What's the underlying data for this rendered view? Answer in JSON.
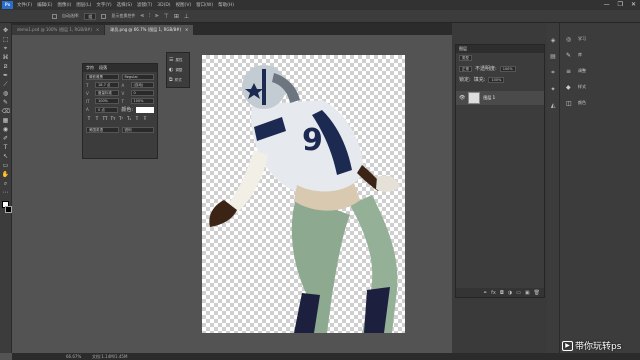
{
  "menu": [
    "文件(F)",
    "编辑(E)",
    "图像(I)",
    "图层(L)",
    "文字(Y)",
    "选择(S)",
    "滤镜(T)",
    "3D(D)",
    "视图(V)",
    "窗口(W)",
    "帮助(H)"
  ],
  "ps_logo": "Ps",
  "window_controls": {
    "minimize": "—",
    "restore": "❐",
    "close": "✕"
  },
  "options_bar": {
    "auto_select": "自动选择:",
    "auto_select_value": "组",
    "show_transform": "显示变换控件"
  },
  "tabs": [
    {
      "label": "demo1.psd @ 100% (图层 1, RGB/8#)",
      "close": "×"
    },
    {
      "label": "球员.png @ 66.7% (图层 1, RGB/8#)",
      "close": "×"
    }
  ],
  "char_panel": {
    "tab1": "字符",
    "tab2": "段落",
    "font_family": "微软雅黑",
    "font_style": "Regular",
    "size": "18.7 点",
    "leading": "(自动)",
    "kerning": "度量标准",
    "tracking": "0",
    "vscale": "100%",
    "hscale": "100%",
    "baseline": "0 点",
    "color_label": "颜色:",
    "styles": [
      "T",
      "T",
      "TT",
      "Tт",
      "T¹",
      "T₁",
      "T",
      "Ŧ"
    ],
    "lang": "美国英语",
    "aa": "锐利"
  },
  "mini_panel": [
    {
      "icon": "☰",
      "label": "属性"
    },
    {
      "icon": "◐",
      "label": "调整"
    },
    {
      "icon": "⧉",
      "label": "样式"
    }
  ],
  "layers_panel": {
    "title": "图层",
    "kind": "类型",
    "blend": "正常",
    "opacity_label": "不透明度:",
    "opacity": "100%",
    "lock_label": "锁定:",
    "fill_label": "填充:",
    "fill": "100%",
    "layer_name": "图层 1",
    "footer_icons": [
      "⚭",
      "fx",
      "◘",
      "◑",
      "▭",
      "▣",
      "🗑"
    ]
  },
  "right_dock": [
    {
      "icon": "◎",
      "label": "学习"
    },
    {
      "icon": "✎",
      "label": "库"
    },
    {
      "icon": "≡",
      "label": "调整"
    },
    {
      "icon": "◆",
      "label": "样式"
    },
    {
      "icon": "◫",
      "label": "颜色"
    }
  ],
  "icon_strip": [
    "◈",
    "▤",
    "⌗",
    "✦",
    "◭"
  ],
  "toolbar": [
    "✥",
    "⬚",
    "⌖",
    "⌘",
    "⧄",
    "✒",
    "⟋",
    "◍",
    "✎",
    "⌫",
    "▦",
    "◉",
    "✐",
    "T",
    "↖",
    "▭",
    "✋",
    "⌕",
    "⋯"
  ],
  "status": {
    "zoom": "66.67%",
    "doc": "文档:1.14M/1.45M"
  },
  "watermark": "带你玩转ps",
  "watermark_icon": "▶"
}
